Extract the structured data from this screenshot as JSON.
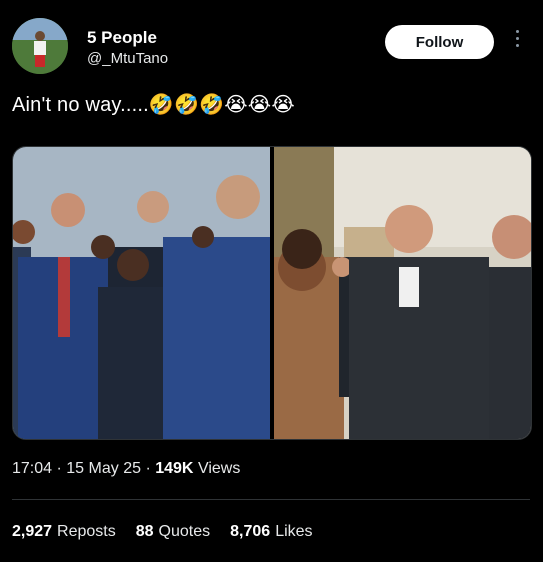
{
  "author": {
    "name": "5 People",
    "handle": "@_MtuTano"
  },
  "follow_label": "Follow",
  "tweet": {
    "text": "Ain't no way.....🤣🤣🤣😭😭😭"
  },
  "meta": {
    "time": "17:04",
    "date": "15 May 25",
    "views_count": "149K",
    "views_label": "Views"
  },
  "stats": {
    "reposts": "2,927",
    "reposts_label": "Reposts",
    "quotes": "88",
    "quotes_label": "Quotes",
    "likes": "8,706",
    "likes_label": "Likes"
  },
  "colors": {
    "background": "#000000",
    "follow_button": "#ffffff"
  }
}
